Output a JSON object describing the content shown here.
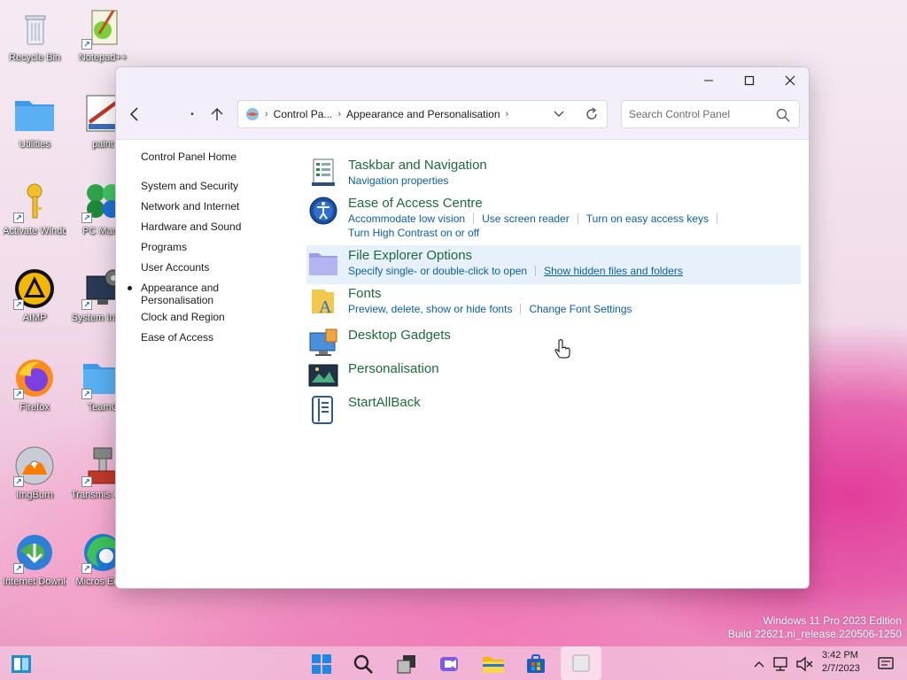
{
  "desktop": {
    "icons": [
      {
        "label": "Recycle Bin"
      },
      {
        "label": "Notepad++"
      },
      {
        "label": "Utilities"
      },
      {
        "label": "paint"
      },
      {
        "label": "Activate Windows"
      },
      {
        "label": "PC Mana"
      },
      {
        "label": "AIMP"
      },
      {
        "label": "System Inform"
      },
      {
        "label": "Firefox"
      },
      {
        "label": "TeamC"
      },
      {
        "label": "ImgBurn"
      },
      {
        "label": "Transmis Qt Clie"
      },
      {
        "label": "Internet Downlo..."
      },
      {
        "label": "Micros Edge"
      }
    ],
    "watermark_line1": "Windows 11 Pro 2023 Edition",
    "watermark_line2": "Build 22621.ni_release.220506-1250"
  },
  "window": {
    "address": {
      "segment1": "Control Pa...",
      "segment2": "Appearance and Personalisation"
    },
    "search_placeholder": "Search Control Panel",
    "left_nav": [
      {
        "label": "Control Panel Home"
      },
      {
        "label": "System and Security"
      },
      {
        "label": "Network and Internet"
      },
      {
        "label": "Hardware and Sound"
      },
      {
        "label": "Programs"
      },
      {
        "label": "User Accounts"
      },
      {
        "label": "Appearance and",
        "label2": "Personalisation"
      },
      {
        "label": "Clock and Region"
      },
      {
        "label": "Ease of Access"
      }
    ],
    "categories": [
      {
        "title": "Taskbar and Navigation",
        "links": [
          "Navigation properties"
        ]
      },
      {
        "title": "Ease of Access Centre",
        "links": [
          "Accommodate low vision",
          "Use screen reader",
          "Turn on easy access keys",
          "Turn High Contrast on or off"
        ]
      },
      {
        "title": "File Explorer Options",
        "links": [
          "Specify single- or double-click to open",
          "Show hidden files and folders"
        ]
      },
      {
        "title": "Fonts",
        "links": [
          "Preview, delete, show or hide fonts",
          "Change Font Settings"
        ]
      },
      {
        "title": "Desktop Gadgets",
        "links": []
      },
      {
        "title": "Personalisation",
        "links": []
      },
      {
        "title": "StartAllBack",
        "links": []
      }
    ]
  },
  "taskbar": {
    "time": "3:42 PM",
    "date": "2/7/2023"
  },
  "colors": {
    "category_title": "#1e6b3a",
    "link": "#0b5fa5",
    "highlight": "#e6f1fb"
  }
}
